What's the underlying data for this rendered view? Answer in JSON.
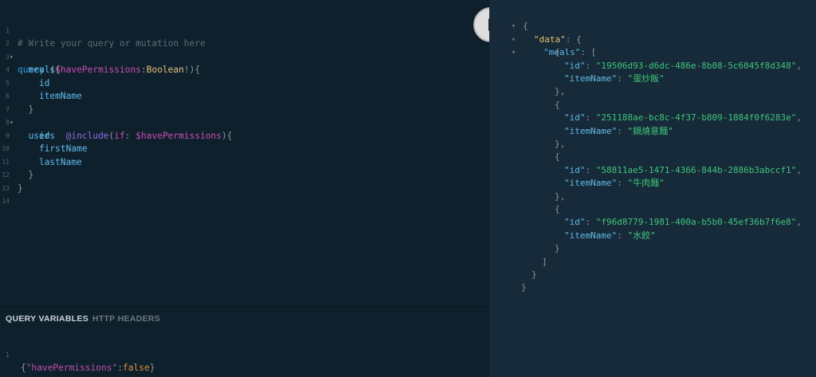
{
  "query_editor": {
    "line_numbers": [
      "1",
      "2",
      "3",
      "4",
      "5",
      "6",
      "7",
      "8",
      "9",
      "10",
      "11",
      "12",
      "13",
      "14"
    ],
    "comment": "# Write your query or mutation here",
    "keyword_query": "query",
    "var_name": "$havePermissions",
    "var_type": "Boolean",
    "field_meals": "meals",
    "field_id": "id",
    "field_itemName": "itemName",
    "field_users": "users",
    "directive": "@include",
    "arg_if": "if",
    "arg_var": "$havePermissions",
    "field_id2": "id",
    "field_firstName": "firstName",
    "field_lastName": "lastName"
  },
  "variables_panel": {
    "tab_query_variables": "QUERY VARIABLES",
    "tab_http_headers": "HTTP HEADERS",
    "line_number": "1",
    "key": "\"havePermissions\"",
    "value": "false"
  },
  "run_button": {
    "icon": "play-icon"
  },
  "result": {
    "data_key": "\"data\"",
    "meals_key": "\"meals\"",
    "id_key": "\"id\"",
    "itemName_key": "\"itemName\"",
    "meals": [
      {
        "id": "\"19506d93-d6dc-486e-8b08-5c6045f8d348\"",
        "itemName": "\"蛋炒飯\""
      },
      {
        "id": "\"251188ae-bc8c-4f37-b809-1884f0f6283e\"",
        "itemName": "\"鍋燒意麵\""
      },
      {
        "id": "\"58811ae5-1471-4366-844b-2886b3abccf1\"",
        "itemName": "\"牛肉麵\""
      },
      {
        "id": "\"f96d8779-1981-400a-b5b0-45ef36b7f6e8\"",
        "itemName": "\"水餃\""
      }
    ]
  },
  "colors": {
    "editor_bg": "#0f202d",
    "result_bg": "#172a3a",
    "keyword": "#2a9bd6",
    "variable": "#c74db0",
    "string": "#3fc57a"
  }
}
